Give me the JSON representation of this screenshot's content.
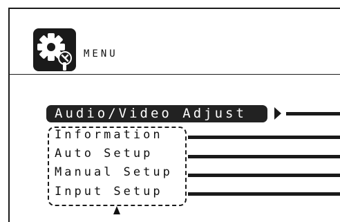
{
  "header": {
    "icon": "gear-wrench-icon",
    "title": "MENU"
  },
  "menu": {
    "selected_label": "Audio/Video Adjust",
    "submenu_items": [
      "Information",
      "Auto Setup",
      "Manual Setup",
      "Input Setup"
    ]
  },
  "colors": {
    "foreground": "#1a1a1a",
    "selected_background": "#222222",
    "selected_text": "#ffffff",
    "background": "#ffffff"
  }
}
